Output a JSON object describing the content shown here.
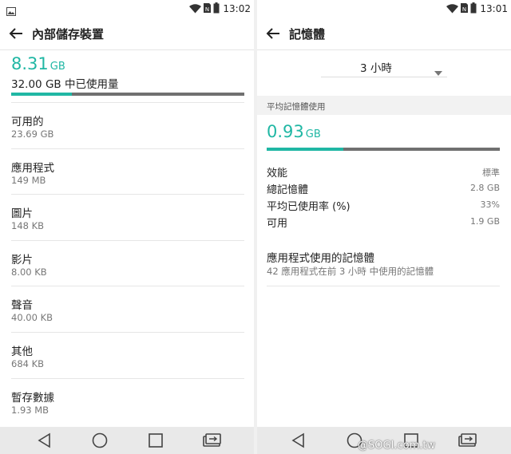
{
  "left": {
    "status": {
      "time": "13:02"
    },
    "appbar": {
      "title": "內部儲存裝置"
    },
    "storage": {
      "used_number": "8.31",
      "used_unit": "GB",
      "caption": "32.00 GB 中已使用量",
      "used_fraction": 0.26
    },
    "items": [
      {
        "label": "可用的",
        "value": "23.69 GB"
      },
      {
        "label": "應用程式",
        "value": "149 MB"
      },
      {
        "label": "圖片",
        "value": "148 KB"
      },
      {
        "label": "影片",
        "value": "8.00 KB"
      },
      {
        "label": "聲音",
        "value": "40.00 KB"
      },
      {
        "label": "其他",
        "value": "684 KB"
      },
      {
        "label": "暫存數據",
        "value": "1.93 MB"
      }
    ]
  },
  "right": {
    "status": {
      "time": "13:01"
    },
    "appbar": {
      "title": "記憶體"
    },
    "period": {
      "selected": "3 小時"
    },
    "section_header": "平均記憶體使用",
    "memory": {
      "used_number": "0.93",
      "used_unit": "GB",
      "used_fraction": 0.33
    },
    "stats": [
      {
        "label": "效能",
        "value": "標準"
      },
      {
        "label": "總記憶體",
        "value": "2.8 GB"
      },
      {
        "label": "平均已使用率 (%)",
        "value": "33%"
      },
      {
        "label": "可用",
        "value": "1.9 GB"
      }
    ],
    "app_memory": {
      "title": "應用程式使用的記憶體",
      "subtitle": "42 應用程式在前 3 小時 中使用的記憶體"
    },
    "watermark": "@SOGI.com.tw"
  },
  "colors": {
    "accent": "#20b7a4",
    "bar_track": "#707070",
    "navbar": "#e9e9e9"
  },
  "icons": {
    "status_left": [
      "gallery-icon"
    ],
    "status_right": [
      "wifi-icon",
      "sim-nfc-icon",
      "battery-icon"
    ],
    "nav": [
      "back-triangle-icon",
      "home-circle-icon",
      "recents-square-icon",
      "dual-window-icon"
    ]
  }
}
